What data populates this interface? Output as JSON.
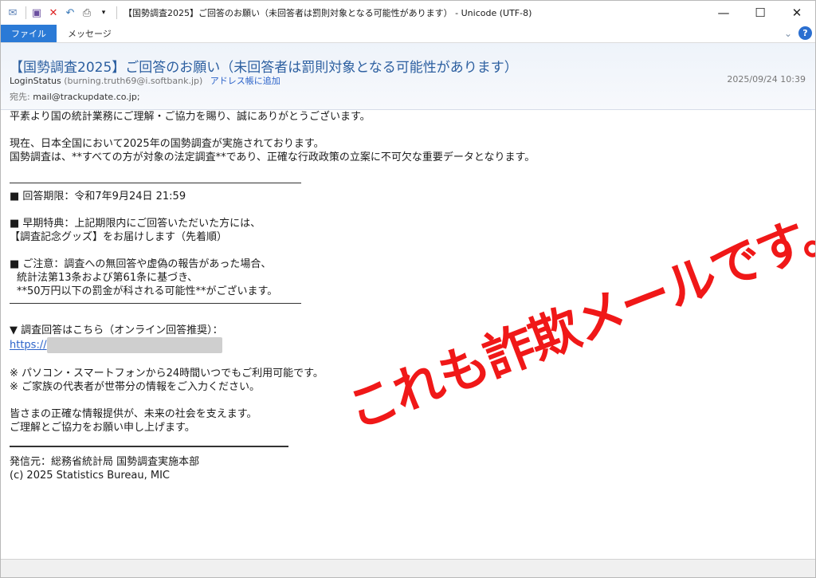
{
  "window": {
    "title": "【国勢調査2025】ご回答のお願い（未回答者は罰則対象となる可能性があります） - Unicode (UTF-8)",
    "controls": {
      "minimize": "—",
      "maximize": "☐",
      "close": "✕"
    }
  },
  "ribbon": {
    "file_tab": "ファイル",
    "message_tab": "メッセージ",
    "help": "?"
  },
  "header": {
    "subject": "【国勢調査2025】ご回答のお願い（未回答者は罰則対象となる可能性があります）",
    "from_name": "LoginStatus",
    "from_email": "(burning.truth69@i.softbank.jp)",
    "add_to_address_book": "アドレス帳に追加",
    "date": "2025/09/24 10:39",
    "to_label": "宛先:",
    "to_value": "mail@trackupdate.co.jp;"
  },
  "body": {
    "line1": "平素より国の統計業務にご理解・ご協力を賜り、誠にありがとうございます。",
    "line2": "現在、日本全国において2025年の国勢調査が実施されております。",
    "line3": "国勢調査は、**すべての方が対象の法定調査**であり、正確な行政政策の立案に不可欠な重要データとなります。",
    "deadline": "■ 回答期限：令和7年9月24日 21:59",
    "bonus1": "■ 早期特典：上記期限内にご回答いただいた方には、",
    "bonus2": "【調査記念グッズ】をお届けします（先着順）",
    "caution1": "■ ご注意：調査への無回答や虚偽の報告があった場合、",
    "caution2": "統計法第13条および第61条に基づき、",
    "caution3": "**50万円以下の罰金が科される可能性**がございます。",
    "link_label": "▼ 調査回答はこちら（オンライン回答推奨）：",
    "link_text": "https://",
    "note1": "※ パソコン・スマートフォンから24時間いつでもご利用可能です。",
    "note2": "※ ご家族の代表者が世帯分の情報をご入力ください。",
    "closing1": "皆さまの正確な情報提供が、未来の社会を支えます。",
    "closing2": "ご理解とご協力をお願い申し上げます。",
    "sender": "発信元：総務省統計局 国勢調査実施本部",
    "copyright": "(c) 2025 Statistics Bureau, MIC"
  },
  "stamp": {
    "text": "これも詐欺メールです。",
    "color": "#f01818"
  }
}
